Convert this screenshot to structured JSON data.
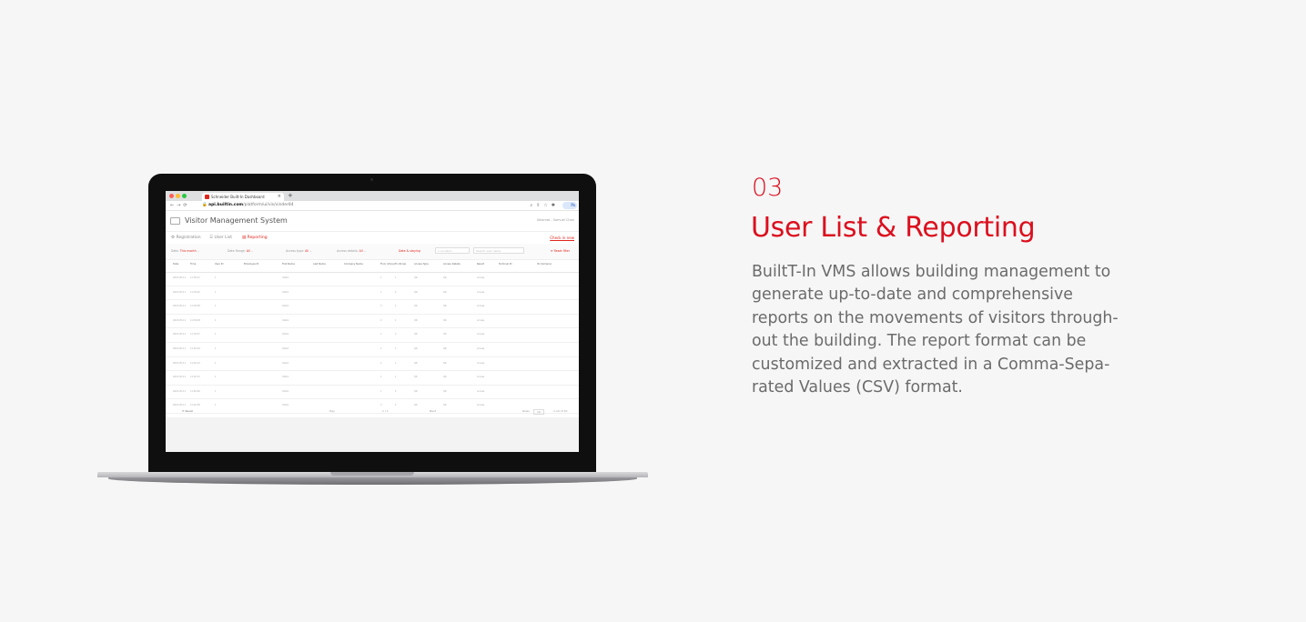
{
  "section": {
    "number": "03",
    "title": "User List & Reporting",
    "description_lines": [
      "BuiltT-In VMS allows building management to",
      "generate up-to-date and comprehensive",
      "reports on the movements of visitors through-",
      "out the building. The report format can be",
      "customized and extracted in a Comma-Sepa-",
      "rated Values (CSV) format."
    ]
  },
  "colors": {
    "accent": "#dc0f1e",
    "body_text": "#6b6b6b",
    "background": "#f6f6f6"
  },
  "laptop": {
    "browser": {
      "tab_title": "Schneider Built-In Dashboard",
      "url_domain": "api.builtin.com",
      "url_path": "/platform/ui/vis/vinder84",
      "profile_label": "Pa"
    },
    "app": {
      "title": "Visitor Management System",
      "user": "Selamat - Samuel Chan",
      "nav": [
        {
          "label": "⚙ Registration",
          "active": false
        },
        {
          "label": "☰ User List",
          "active": false
        },
        {
          "label": "▤ Reporting",
          "active": true
        }
      ],
      "logout_label": "Check in new",
      "filters": {
        "f1": "Date: ",
        "f1_val": "This month",
        "f2": "Date Range: ",
        "f2_val": "All",
        "f3": "Access type: ",
        "f3_val": "All",
        "f4": "Access details: ",
        "f4_val": "All",
        "f5": "Date & staying",
        "box1": "1 Location",
        "box2": "Search user name",
        "reset": "⟳ Reset filter"
      },
      "columns": [
        "Date",
        "Time",
        "User ID",
        "Employee ID",
        "First Name",
        "Last Name",
        "Company Name",
        "Floor (Zone)",
        "To (Zone)",
        "Access Type",
        "Access Details",
        "Result",
        "Terminal ID",
        "ID (Camera)"
      ],
      "rows": [
        [
          "2023-05-11",
          "11:38:11",
          "1",
          "",
          "Visitor",
          "",
          "",
          "1",
          "1",
          "QR",
          "QR",
          "Access",
          "",
          ""
        ],
        [
          "2023-05-11",
          "11:39:22",
          "1",
          "",
          "Visitor",
          "",
          "",
          "1",
          "2",
          "QR",
          "QR",
          "Access",
          "",
          ""
        ],
        [
          "2023-05-11",
          "11:39:38",
          "1",
          "",
          "Visitor",
          "",
          "",
          "3",
          "1",
          "QR",
          "QR",
          "Access",
          "",
          ""
        ],
        [
          "2023-05-11",
          "11:39:48",
          "1",
          "",
          "Visitor",
          "",
          "",
          "2",
          "1",
          "QR",
          "QR",
          "Access",
          "",
          ""
        ],
        [
          "2023-05-11",
          "11:39:57",
          "1",
          "",
          "Visitor",
          "",
          "",
          "1",
          "2",
          "QR",
          "QR",
          "Access",
          "",
          ""
        ],
        [
          "2023-05-11",
          "11:40:04",
          "1",
          "",
          "Visitor",
          "",
          "",
          "1",
          "1",
          "QR",
          "QR",
          "Access",
          "",
          ""
        ],
        [
          "2023-05-11",
          "11:40:23",
          "1",
          "",
          "Visitor",
          "",
          "",
          "2",
          "1",
          "QR",
          "QR",
          "Access",
          "",
          ""
        ],
        [
          "2023-05-11",
          "11:40:31",
          "1",
          "",
          "Visitor",
          "",
          "",
          "1",
          "1",
          "QR",
          "QR",
          "Access",
          "",
          ""
        ],
        [
          "2023-05-11",
          "11:40:46",
          "1",
          "",
          "Visitor",
          "",
          "",
          "1",
          "2",
          "QR",
          "QR",
          "Access",
          "",
          ""
        ],
        [
          "2023-05-11",
          "11:40:58",
          "1",
          "",
          "Visitor",
          "",
          "",
          "3",
          "1",
          "QR",
          "QR",
          "Access",
          "",
          ""
        ]
      ],
      "footer": {
        "reset": "⟳ Reset",
        "mid1": "Day",
        "mid2": "1 / 1",
        "mid3": "Next",
        "rows_label": "Rows",
        "rows_value": "10",
        "range": "1-10 of 10"
      }
    }
  }
}
